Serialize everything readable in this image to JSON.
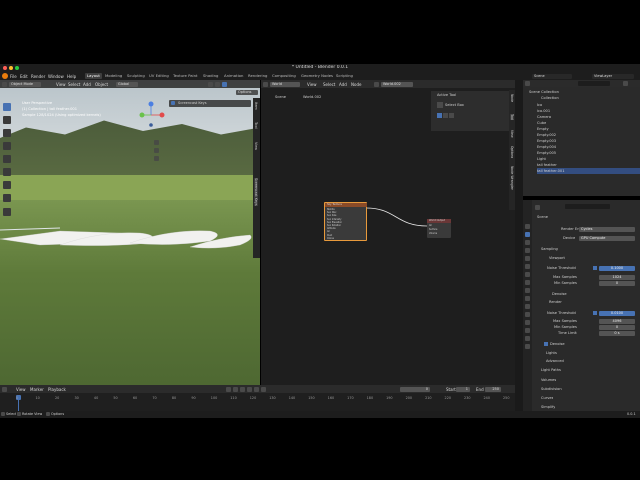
{
  "window": {
    "title": "* Untitled - Blender 0.0.1"
  },
  "menu": {
    "items": [
      "File",
      "Edit",
      "Render",
      "Window",
      "Help"
    ],
    "workspaces": [
      "Layout",
      "Modeling",
      "Sculpting",
      "UV Editing",
      "Texture Paint",
      "Shading",
      "Animation",
      "Rendering",
      "Compositing",
      "Geometry Nodes",
      "Scripting"
    ],
    "active_workspace": "Layout",
    "scene": "Scene",
    "view_layer": "ViewLayer"
  },
  "viewport": {
    "mode": "Object Mode",
    "menus": [
      "View",
      "Select",
      "Add",
      "Object"
    ],
    "orientation": "Global",
    "info_line1": "User Perspective",
    "info_line2": "(1) Collection | tall feather.001",
    "info_line3": "Sample 128/1024 (Using optimized kernels)",
    "options_label": "Options",
    "overlay_label": "Screencast Keys",
    "side_tabs": [
      "Item",
      "Tool",
      "View",
      "Screencast Keys"
    ]
  },
  "node_editor": {
    "editor": "World",
    "menus": [
      "View",
      "Select",
      "Add",
      "Node"
    ],
    "world_name": "World.002",
    "breadcrumb": [
      "Scene",
      "World.002"
    ],
    "active_tool_title": "Active Tool",
    "active_tool_name": "Select Box",
    "node1_title": "Sky Texture",
    "node1_rows": [
      "Nishita",
      "Sun Disc",
      "Sun Size",
      "Sun Intensity",
      "Sun Elevation",
      "Sun Rotation",
      "Altitude",
      "Air",
      "Dust",
      "Ozone"
    ],
    "node2_title": "World Output",
    "node2_rows": [
      "All",
      "Surface",
      "Volume"
    ],
    "side_tabs": [
      "Node",
      "Tool",
      "View",
      "Options",
      "Node Wrangler"
    ]
  },
  "outliner": {
    "title": "Scene Collection",
    "root": "Collection",
    "items": [
      "Ico",
      "ico.001",
      "Camera",
      "Cube",
      "Empty",
      "Empty.002",
      "Empty.003",
      "Empty.004",
      "Empty.005",
      "Light",
      "tall feather",
      "tall feather.001"
    ]
  },
  "properties": {
    "search_placeholder": "",
    "scene_label": "Scene",
    "render_engine_label": "Render Engine",
    "render_engine": "Cycles",
    "device_label": "Device",
    "device": "GPU Compute",
    "sampling": "Sampling",
    "viewport": "Viewport",
    "render": "Render",
    "noise_threshold_label": "Noise Threshold",
    "vp_noise_threshold": "0.1000",
    "vp_max_samples_label": "Max Samples",
    "vp_max_samples": "1024",
    "vp_min_samples_label": "Min Samples",
    "vp_min_samples": "0",
    "denoise": "Denoise",
    "r_noise_threshold": "0.0100",
    "r_max_samples_label": "Max Samples",
    "r_max_samples": "4096",
    "r_min_samples_label": "Min Samples",
    "r_min_samples": "0",
    "time_limit_label": "Time Limit",
    "time_limit": "0 s",
    "lights": "Lights",
    "advanced": "Advanced",
    "light_paths": "Light Paths",
    "volumes": "Volumes",
    "subdivision": "Subdivision",
    "curves": "Curves",
    "simplify": "Simplify"
  },
  "timeline": {
    "menus": [
      "View",
      "Marker",
      "Playback"
    ],
    "current_frame": "0",
    "start_label": "Start",
    "start": "1",
    "end_label": "End",
    "end": "250",
    "ticks": [
      "0",
      "10",
      "20",
      "30",
      "40",
      "50",
      "60",
      "70",
      "80",
      "90",
      "100",
      "110",
      "120",
      "130",
      "140",
      "150",
      "160",
      "170",
      "180",
      "190",
      "200",
      "210",
      "220",
      "230",
      "240",
      "250"
    ]
  },
  "status": {
    "select": "Select",
    "rotate": "Rotate View",
    "options": "Options",
    "version": "0.0.1"
  }
}
